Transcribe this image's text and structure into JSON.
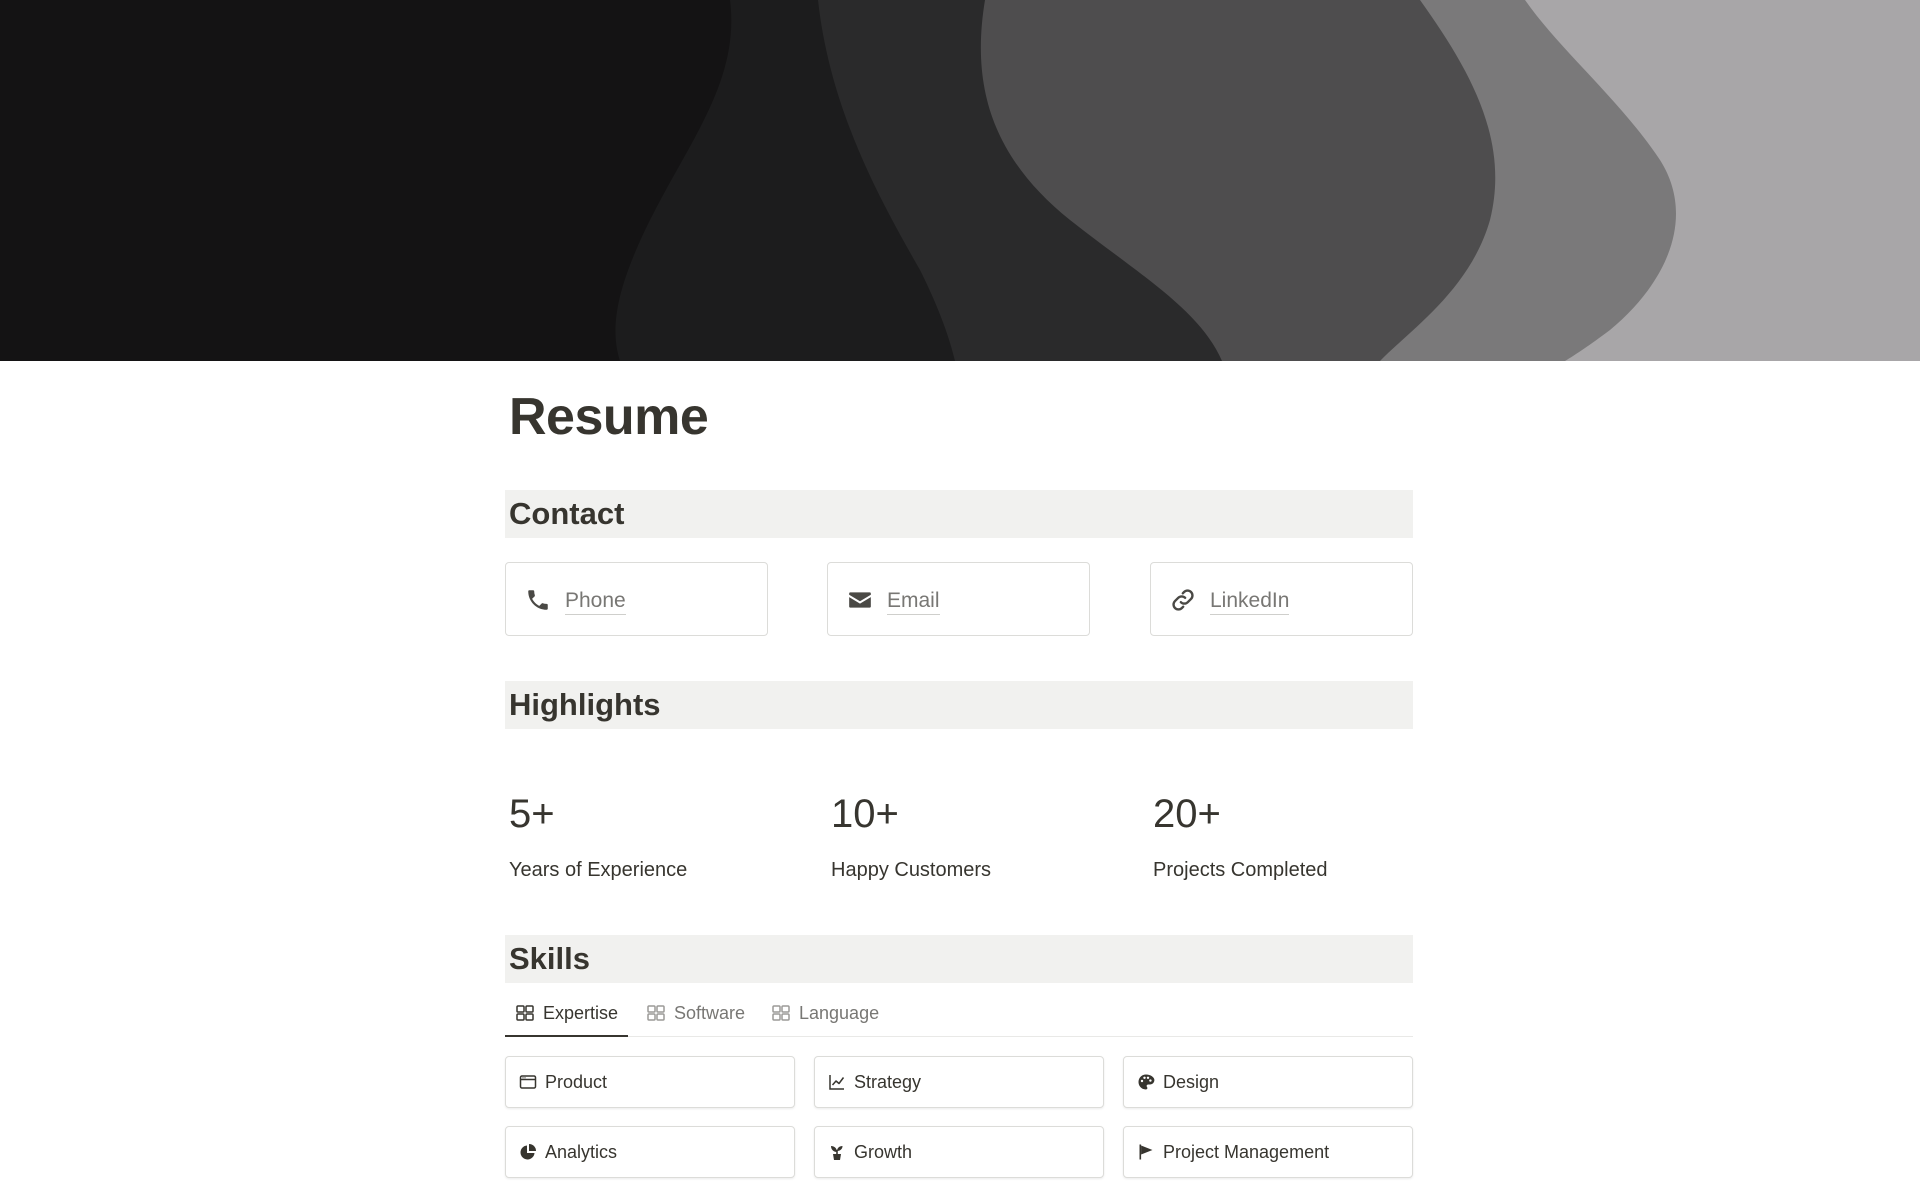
{
  "page": {
    "title": "Resume"
  },
  "contact": {
    "heading": "Contact",
    "items": [
      {
        "label": "Phone",
        "icon": "phone-icon"
      },
      {
        "label": "Email",
        "icon": "envelope-icon"
      },
      {
        "label": "LinkedIn",
        "icon": "link-icon"
      }
    ]
  },
  "highlights": {
    "heading": "Highlights",
    "items": [
      {
        "value": "5+",
        "label": "Years of Experience"
      },
      {
        "value": "10+",
        "label": "Happy Customers"
      },
      {
        "value": "20+",
        "label": "Projects Completed"
      }
    ]
  },
  "skills": {
    "heading": "Skills",
    "tabs": [
      {
        "label": "Expertise",
        "icon": "gallery-view-icon",
        "active": true
      },
      {
        "label": "Software",
        "icon": "gallery-view-icon",
        "active": false
      },
      {
        "label": "Language",
        "icon": "gallery-view-icon",
        "active": false
      }
    ],
    "cards": [
      {
        "label": "Product",
        "icon": "browser-window-icon"
      },
      {
        "label": "Strategy",
        "icon": "line-chart-icon"
      },
      {
        "label": "Design",
        "icon": "palette-icon"
      },
      {
        "label": "Analytics",
        "icon": "pie-chart-icon"
      },
      {
        "label": "Growth",
        "icon": "sprout-icon"
      },
      {
        "label": "Project Management",
        "icon": "flag-icon"
      }
    ]
  },
  "colors": {
    "text": "#37352f",
    "muted": "#787774",
    "heading_bg": "#f1f1ef",
    "border": "#dcdcd9"
  }
}
